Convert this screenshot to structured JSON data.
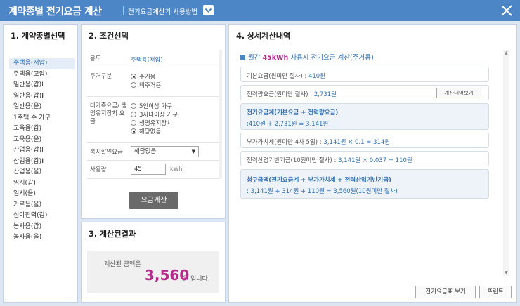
{
  "window": {
    "title": "계약종별 전기요금 계산",
    "howto_label": "전기요금계산기 사용방법",
    "close_icon": "close-icon",
    "accent_color": "#4d86c6"
  },
  "panel1": {
    "heading": "1. 계약종별선택",
    "items": [
      {
        "label": "주택용(저압)",
        "selected": true
      },
      {
        "label": "주택용(고압)",
        "selected": false
      },
      {
        "label": "일반용(갑)Ⅰ",
        "selected": false
      },
      {
        "label": "일반용(갑)Ⅱ",
        "selected": false
      },
      {
        "label": "일반용(을)",
        "selected": false
      },
      {
        "label": "1주택 수 가구",
        "selected": false
      },
      {
        "label": "교육용(갑)",
        "selected": false
      },
      {
        "label": "교육용(을)",
        "selected": false
      },
      {
        "label": "산업용(갑)Ⅰ",
        "selected": false
      },
      {
        "label": "산업용(갑)Ⅱ",
        "selected": false
      },
      {
        "label": "산업용(을)",
        "selected": false
      },
      {
        "label": "임시(갑)",
        "selected": false
      },
      {
        "label": "임시(을)",
        "selected": false
      },
      {
        "label": "가로등(을)",
        "selected": false
      },
      {
        "label": "심야전력(갑)",
        "selected": false
      },
      {
        "label": "농사용(갑)",
        "selected": false
      },
      {
        "label": "농사용(을)",
        "selected": false
      }
    ]
  },
  "panel2": {
    "heading": "2. 조건선택",
    "usage_label": "용도",
    "usage_value": "주택용(저압)",
    "residence_label": "주거구분",
    "residence_options": [
      {
        "label": "주거용",
        "checked": true
      },
      {
        "label": "비주거용",
        "checked": false
      }
    ],
    "discount_label": "대가족요금/ 생명유지장치 요금",
    "discount_options": [
      {
        "label": "5인이상 가구",
        "checked": false
      },
      {
        "label": "3자녀이상 가구",
        "checked": false
      },
      {
        "label": "생명유지장치",
        "checked": false
      },
      {
        "label": "해당없음",
        "checked": true
      }
    ],
    "welfare_label": "복지할인요금",
    "welfare_value": "해당없음",
    "usage_amount_label": "사용량",
    "usage_amount_value": "45",
    "usage_amount_unit": "kWh",
    "calc_button": "요금계산"
  },
  "panel3": {
    "heading": "3. 계산된결과",
    "line1": "계산된 금액은",
    "amount": "3,560",
    "won": "원",
    "tail": "입니다."
  },
  "panel4": {
    "heading": "4. 상세계산내역",
    "headline_prefix": "월간",
    "headline_kwh": "45kWh",
    "headline_suffix": "사용시 전기요금 계산(주거용)",
    "base_label": "기본요금(원미만 절사) :",
    "base_value": "410원",
    "energy_label": "전력량요금(원미만 절사) :",
    "energy_value": "2,731원",
    "detail_button": "계산내역보기",
    "sum_heading": "전기요금계(기본요금 + 전력량요금)",
    "sum_formula": ":410원 + 2,731원 = 3,141원",
    "vat_label": "부가가치세(원미만 4사 5입) :",
    "vat_value": "3,141원 × 0.1 = 314원",
    "fund_label": "전력산업기반기금(10원미만 절사) :",
    "fund_value": "3,141원 × 0.037 = 110원",
    "bill_heading": "청구금액(전기요금계 + 부가가치세 + 전력산업기반기금)",
    "bill_formula": ": 3,141원 + 314원 + 110원 = 3,560원(10원미만 절사)",
    "tariff_button": "전기요금표 보기",
    "print_button": "프린트"
  }
}
